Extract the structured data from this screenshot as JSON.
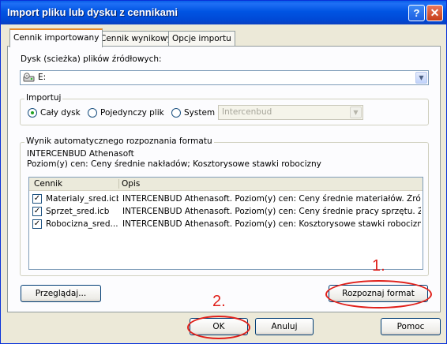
{
  "window": {
    "title": "Import pliku lub dysku z cennikami",
    "help_glyph": "?",
    "close_glyph": "✕"
  },
  "tabs": [
    {
      "label": "Cennik importowany"
    },
    {
      "label": "Cennik wynikowy"
    },
    {
      "label": "Opcje importu"
    }
  ],
  "disk": {
    "label": "Dysk (scieżka) plików źródłowych:",
    "value": "E:"
  },
  "import_group": {
    "title": "Importuj",
    "radios": [
      {
        "label": "Cały dysk",
        "checked": true
      },
      {
        "label": "Pojedynczy plik",
        "checked": false
      },
      {
        "label": "System",
        "checked": false
      }
    ],
    "system_value": "Intercenbud"
  },
  "format_group": {
    "title": "Wynik automatycznego rozpoznania formatu",
    "line1": "INTERCENBUD Athenasoft",
    "line2": "Poziom(y) cen: Ceny średnie nakładów; Kosztorysowe stawki robocizny",
    "columns": {
      "cennik": "Cennik",
      "opis": "Opis"
    },
    "rows": [
      {
        "checked": true,
        "cennik": "Materialy_sred.icb",
        "opis": "INTERCENBUD Athenasoft. Poziom(y) cen: Ceny średnie materiałów. Źródło..."
      },
      {
        "checked": true,
        "cennik": "Sprzet_sred.icb",
        "opis": "INTERCENBUD Athenasoft. Poziom(y) cen: Ceny średnie pracy sprzętu. Źród..."
      },
      {
        "checked": true,
        "cennik": "Robocizna_sred...",
        "opis": "INTERCENBUD Athenasoft. Poziom(y) cen: Kosztorysowe stawki robocizny. ..."
      }
    ]
  },
  "buttons": {
    "browse": "Przeglądaj...",
    "recognize": "Rozpoznaj format",
    "ok": "OK",
    "cancel": "Anuluj",
    "help": "Pomoc"
  },
  "annotations": {
    "step1": "1.",
    "step2": "2.",
    "color": "#e0201a"
  },
  "colors": {
    "title_bar": "#0054e3",
    "dialog_bg": "#ece9d8",
    "tab_accent": "#e68b2c"
  },
  "icons": {
    "drive": "drive-icon",
    "combo_arrow": "chevron-down-icon",
    "check": "checkmark-icon"
  }
}
